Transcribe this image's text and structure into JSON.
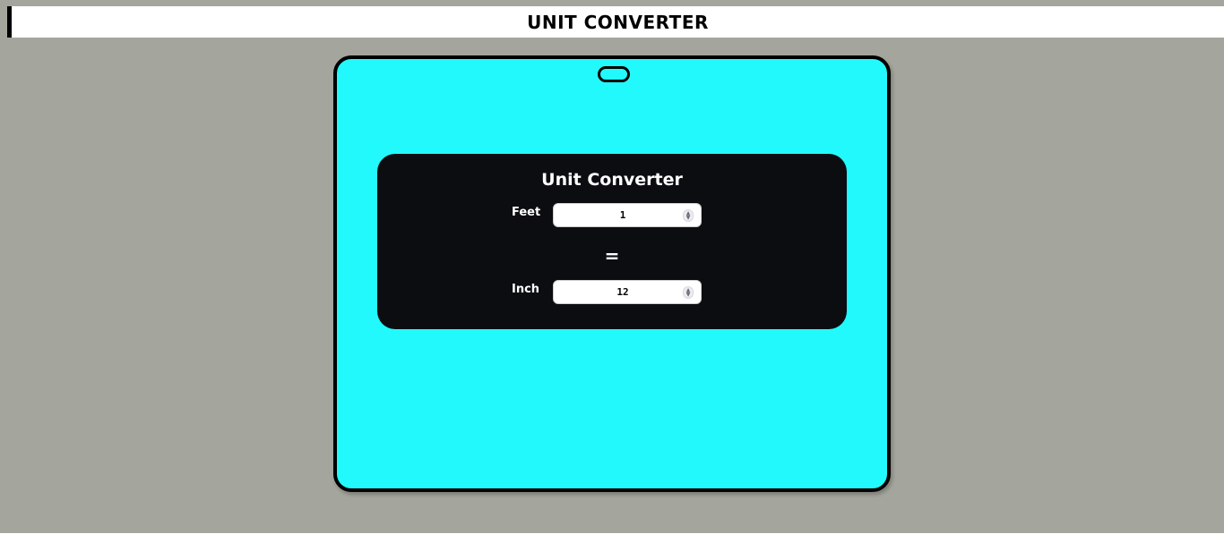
{
  "header": {
    "title": "UNIT CONVERTER"
  },
  "converter": {
    "title": "Unit Converter",
    "from_label": "Feet",
    "from_value": "1",
    "equals_sign": "=",
    "to_label": "Inch",
    "to_value": "12"
  },
  "colors": {
    "page_background": "#a4a69d",
    "header_background": "#ffffff",
    "device_background": "#22f9fc",
    "panel_background": "#0c0d11",
    "text_light": "#ffffff",
    "text_dark": "#000000"
  },
  "icons": {
    "stepper": "up-down-spinner-icon",
    "speaker": "speaker-slot-icon"
  }
}
